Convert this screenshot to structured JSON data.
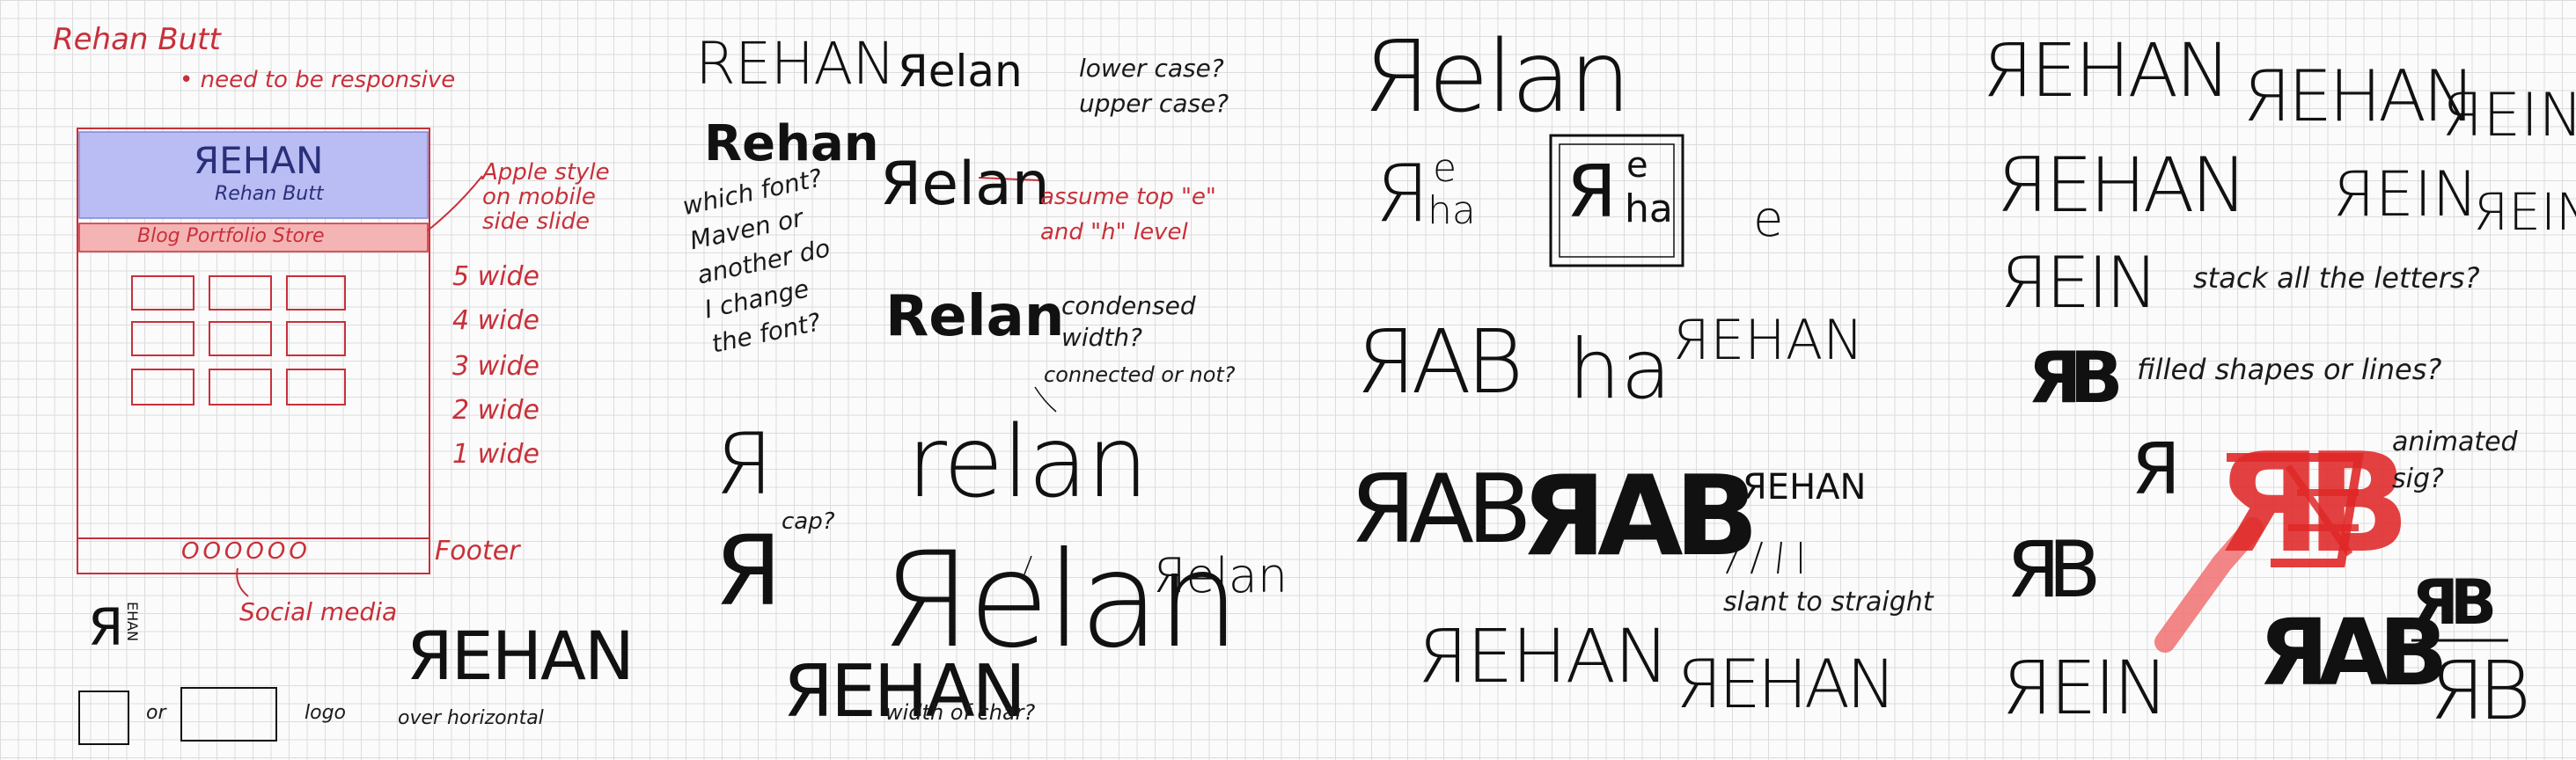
{
  "sketch_notes": {
    "author": "Rehan Butt",
    "responsive_note": "• need to be responsive",
    "header_logo": "ЯEHAN",
    "header_name": "Rehan Butt",
    "nav_bar": "Blog  Portfolio  Store",
    "apple_note": "Apple style on mobile side slide",
    "grid_widths": [
      "5 wide",
      "4 wide",
      "3 wide",
      "2 wide",
      "1 wide"
    ],
    "footer_label": "Footer",
    "footer_icons": "OOOOOO",
    "social_media": "Social media",
    "logo_label": "logo",
    "or_label": "or",
    "over_horizontal": "over horizontal",
    "stacked_r": "Я",
    "stacked_ehan": "EHAN"
  },
  "column2": {
    "rehan_caps": "REHAN",
    "rehan_bold": "Rehan",
    "relan_1": "Яelan",
    "lower_upper": "lower case? upper case?",
    "relan_2": "Яelan",
    "assume_note": "assume top \"e\" and \"h\" level",
    "which_font": "which font? Maven or another do I change the font?",
    "relan_3": "Relan",
    "condensed": "condensed width?",
    "connected": "connected or not?",
    "rehan_large": "relan",
    "cap_note": "cap?",
    "relan_big": "Яelan",
    "relan_small": "Яelan",
    "rehan_bottom": "ЯEHAN",
    "width_char": "width of char?",
    "r_mark": "Я"
  },
  "column3": {
    "relan_top": "Яelan",
    "e_char": "e",
    "rab": "ЯAB",
    "ha": "ha",
    "rehan_hook": "ЯEHAN",
    "slant_note": "slant to straight",
    "rehan_bottom": "ЯEHAN",
    "rehan_bottom2": "ЯEHAN"
  },
  "column4": {
    "rehan_1": "ЯEHAN",
    "rehan_2": "ЯEHAN",
    "rein_1": "ЯEIN",
    "rehan_3": "ЯEHAN",
    "rein_2": "ЯEIN",
    "rein_3": "ЯEIN",
    "rein_4": "ЯEIN",
    "stack_note": "stack all the letters?",
    "filled_note": "filled shapes or lines?",
    "animated_note": "animated sig?",
    "rab_bold": "ЯAB",
    "rb_mark": "ЯB",
    "r_mark": "Я",
    "rein_bottom": "ЯEIN"
  }
}
